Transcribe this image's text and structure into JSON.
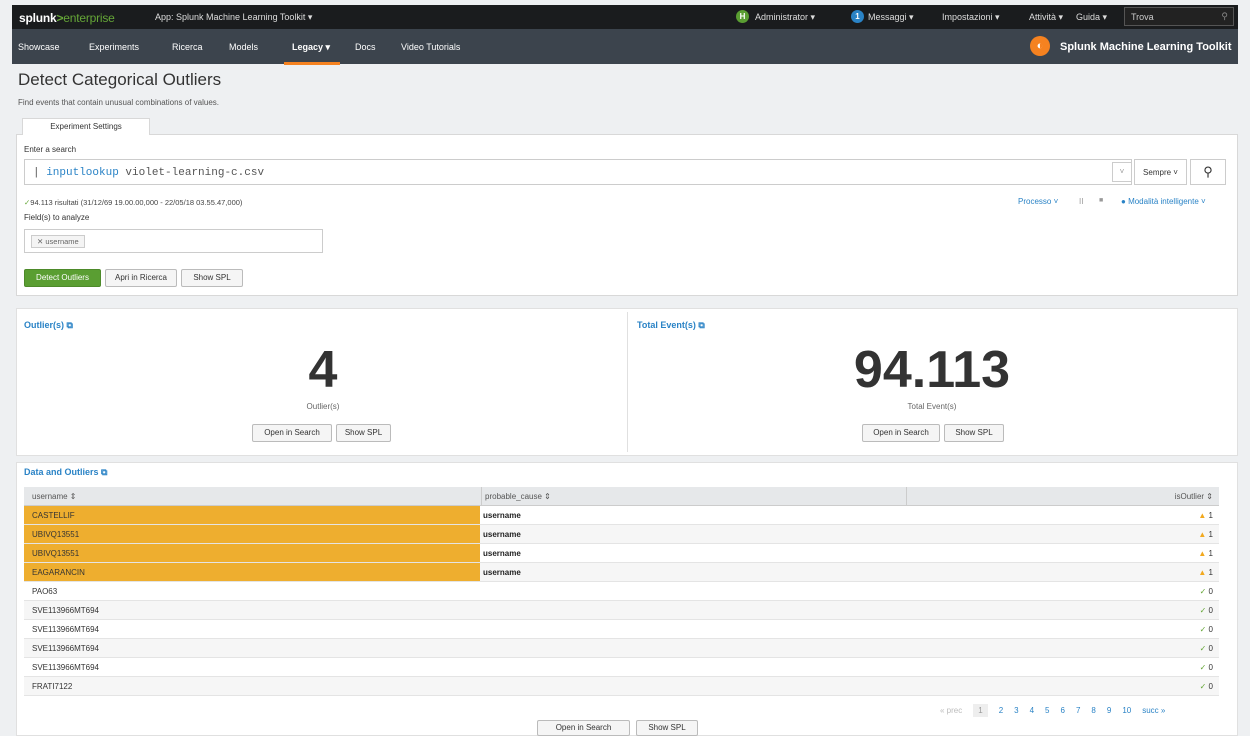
{
  "topbar": {
    "brand_a": "splunk",
    "brand_gt": ">",
    "brand_b": "enterprise",
    "app": "App: Splunk Machine Learning Toolkit ▾",
    "user_initial": "H",
    "user": "Administrator ▾",
    "messages_count": "1",
    "messages": "Messaggi ▾",
    "settings": "Impostazioni ▾",
    "activity": "Attività ▾",
    "help": "Guida ▾",
    "find": "Trova"
  },
  "appbar": {
    "nav": [
      "Showcase",
      "Experiments",
      "Ricerca",
      "Models",
      "Legacy ▾",
      "Docs",
      "Video Tutorials"
    ],
    "title": "Splunk Machine Learning Toolkit"
  },
  "page": {
    "title": "Detect Categorical Outliers",
    "subtitle": "Find events that contain unusual combinations of values."
  },
  "settings": {
    "tab": "Experiment Settings",
    "enter_search": "Enter a search",
    "query_pipe": "| ",
    "query_cmd": "inputlookup",
    "query_arg": " violet-learning-c.csv",
    "time": "Sempre ˅",
    "results": "94.113 risultati (31/12/69 19.00.00,000 - 22/05/18 03.55.47,000)",
    "process": "Processo ˅",
    "pause": "II",
    "stop": "■",
    "mode": "Modalità intelligente ˅",
    "fields_label": "Field(s) to analyze",
    "field_chip": "username",
    "btn_detect": "Detect Outliers",
    "btn_open": "Apri in Ricerca",
    "btn_spl": "Show SPL"
  },
  "outliers_panel": {
    "title": "Outlier(s)",
    "value": "4",
    "caption": "Outlier(s)",
    "btn_open": "Open in Search",
    "btn_spl": "Show SPL"
  },
  "events_panel": {
    "title": "Total Event(s)",
    "value": "94.113",
    "caption": "Total Event(s)",
    "btn_open": "Open in Search",
    "btn_spl": "Show SPL"
  },
  "table": {
    "title": "Data and Outliers",
    "headers": [
      "username ⇕",
      "probable_cause ⇕",
      "isOutlier ⇕"
    ],
    "rows": [
      {
        "username": "CASTELLIF",
        "cause": "username",
        "outlier": "1"
      },
      {
        "username": "UBIVQ13551",
        "cause": "username",
        "outlier": "1"
      },
      {
        "username": "UBIVQ13551",
        "cause": "username",
        "outlier": "1"
      },
      {
        "username": "EAGARANCIN",
        "cause": "username",
        "outlier": "1"
      },
      {
        "username": "PAO63",
        "cause": "",
        "outlier": "0"
      },
      {
        "username": "SVE113966MT694",
        "cause": "",
        "outlier": "0"
      },
      {
        "username": "SVE113966MT694",
        "cause": "",
        "outlier": "0"
      },
      {
        "username": "SVE113966MT694",
        "cause": "",
        "outlier": "0"
      },
      {
        "username": "SVE113966MT694",
        "cause": "",
        "outlier": "0"
      },
      {
        "username": "FRATI7122",
        "cause": "",
        "outlier": "0"
      }
    ],
    "highlight_color": "#eeae2f",
    "pager": [
      "« prec",
      "1",
      "2",
      "3",
      "4",
      "5",
      "6",
      "7",
      "8",
      "9",
      "10",
      "succ »"
    ],
    "btn_open": "Open in Search",
    "btn_spl": "Show SPL"
  }
}
